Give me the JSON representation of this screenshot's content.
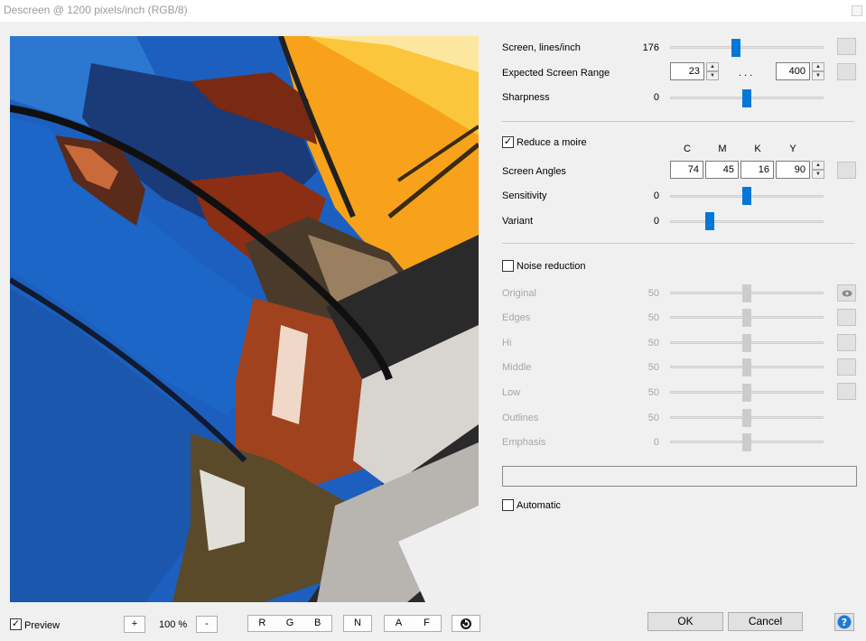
{
  "window": {
    "title": "Descreen @ 1200 pixels/inch (RGB/8)"
  },
  "main": {
    "screen_lines": {
      "label": "Screen, lines/inch",
      "value": "176",
      "level": 0.43
    },
    "screen_range": {
      "label": "Expected Screen Range",
      "min": "23",
      "separator": ". . .",
      "max": "400"
    },
    "sharpness": {
      "label": "Sharpness",
      "value": "0",
      "level": 0.5
    },
    "reduce_moire": {
      "label": "Reduce a moire",
      "checked": true
    },
    "angle_columns": [
      "C",
      "M",
      "K",
      "Y"
    ],
    "screen_angles": {
      "label": "Screen Angles",
      "values": [
        "74",
        "45",
        "16",
        "90"
      ]
    },
    "sensitivity": {
      "label": "Sensitivity",
      "value": "0",
      "level": 0.5
    },
    "variant": {
      "label": "Variant",
      "value": "0",
      "level": 0.26
    }
  },
  "noise": {
    "label": "Noise reduction",
    "checked": false,
    "sliders": [
      {
        "label": "Original",
        "value": "50",
        "level": 0.5
      },
      {
        "label": "Edges",
        "value": "50",
        "level": 0.5
      },
      {
        "label": "Hi",
        "value": "50",
        "level": 0.5
      },
      {
        "label": "Middle",
        "value": "50",
        "level": 0.5
      },
      {
        "label": "Low",
        "value": "50",
        "level": 0.5
      },
      {
        "label": "Outlines",
        "value": "50",
        "level": 0.5
      },
      {
        "label": "Emphasis",
        "value": "0",
        "level": 0.5
      }
    ]
  },
  "automatic": {
    "label": "Automatic",
    "checked": false
  },
  "bottom": {
    "preview": {
      "label": "Preview",
      "checked": true
    },
    "zoom_in": "+",
    "zoom": "100 %",
    "zoom_out": "-",
    "channels": [
      "R",
      "G",
      "B"
    ],
    "n": "N",
    "af": [
      "A",
      "F"
    ],
    "ok": "OK",
    "cancel": "Cancel"
  },
  "colors": {
    "accent": "#0078d7",
    "disabled_thumb": "#cccccc",
    "help": "#1e7ad6"
  },
  "icons": {
    "preview_reset": "refresh-icon",
    "help": "question-icon",
    "original_eye": "eye-icon"
  }
}
